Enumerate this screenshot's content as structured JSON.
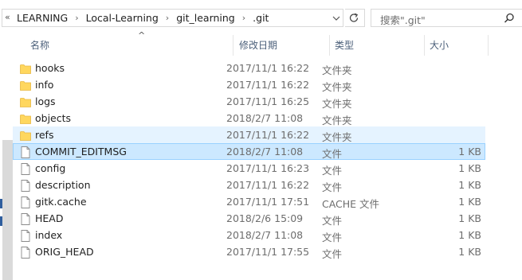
{
  "address_bar": {
    "overflow": "«",
    "crumbs": [
      "LEARNING",
      "Local-Learning",
      "git_learning",
      ".git"
    ]
  },
  "search": {
    "placeholder": "搜索\".git\""
  },
  "columns": {
    "name": "名称",
    "date": "修改日期",
    "type": "类型",
    "size": "大小"
  },
  "files": [
    {
      "name": "hooks",
      "date": "2017/11/1 16:22",
      "type": "文件夹",
      "size": "",
      "kind": "folder"
    },
    {
      "name": "info",
      "date": "2017/11/1 16:22",
      "type": "文件夹",
      "size": "",
      "kind": "folder"
    },
    {
      "name": "logs",
      "date": "2017/11/1 16:25",
      "type": "文件夹",
      "size": "",
      "kind": "folder"
    },
    {
      "name": "objects",
      "date": "2018/2/7 11:08",
      "type": "文件夹",
      "size": "",
      "kind": "folder"
    },
    {
      "name": "refs",
      "date": "2017/11/1 16:22",
      "type": "文件夹",
      "size": "",
      "kind": "folder",
      "state": "hover"
    },
    {
      "name": "COMMIT_EDITMSG",
      "date": "2018/2/7 11:08",
      "type": "文件",
      "size": "1 KB",
      "kind": "file",
      "state": "selected"
    },
    {
      "name": "config",
      "date": "2017/11/1 16:23",
      "type": "文件",
      "size": "1 KB",
      "kind": "file"
    },
    {
      "name": "description",
      "date": "2017/11/1 16:22",
      "type": "文件",
      "size": "1 KB",
      "kind": "file"
    },
    {
      "name": "gitk.cache",
      "date": "2017/11/1 17:51",
      "type": "CACHE 文件",
      "size": "1 KB",
      "kind": "file"
    },
    {
      "name": "HEAD",
      "date": "2018/2/6 15:09",
      "type": "文件",
      "size": "1 KB",
      "kind": "file"
    },
    {
      "name": "index",
      "date": "2018/2/7 11:08",
      "type": "文件",
      "size": "1 KB",
      "kind": "file"
    },
    {
      "name": "ORIG_HEAD",
      "date": "2017/11/1 17:55",
      "type": "文件",
      "size": "1 KB",
      "kind": "file"
    }
  ],
  "colors": {
    "folder": "#ffd75e",
    "folder_dark": "#e8b842",
    "selected_bg": "#cce8ff",
    "selected_border": "#99d1ff",
    "hover_bg": "#e5f3ff",
    "header_text": "#4c607a"
  }
}
